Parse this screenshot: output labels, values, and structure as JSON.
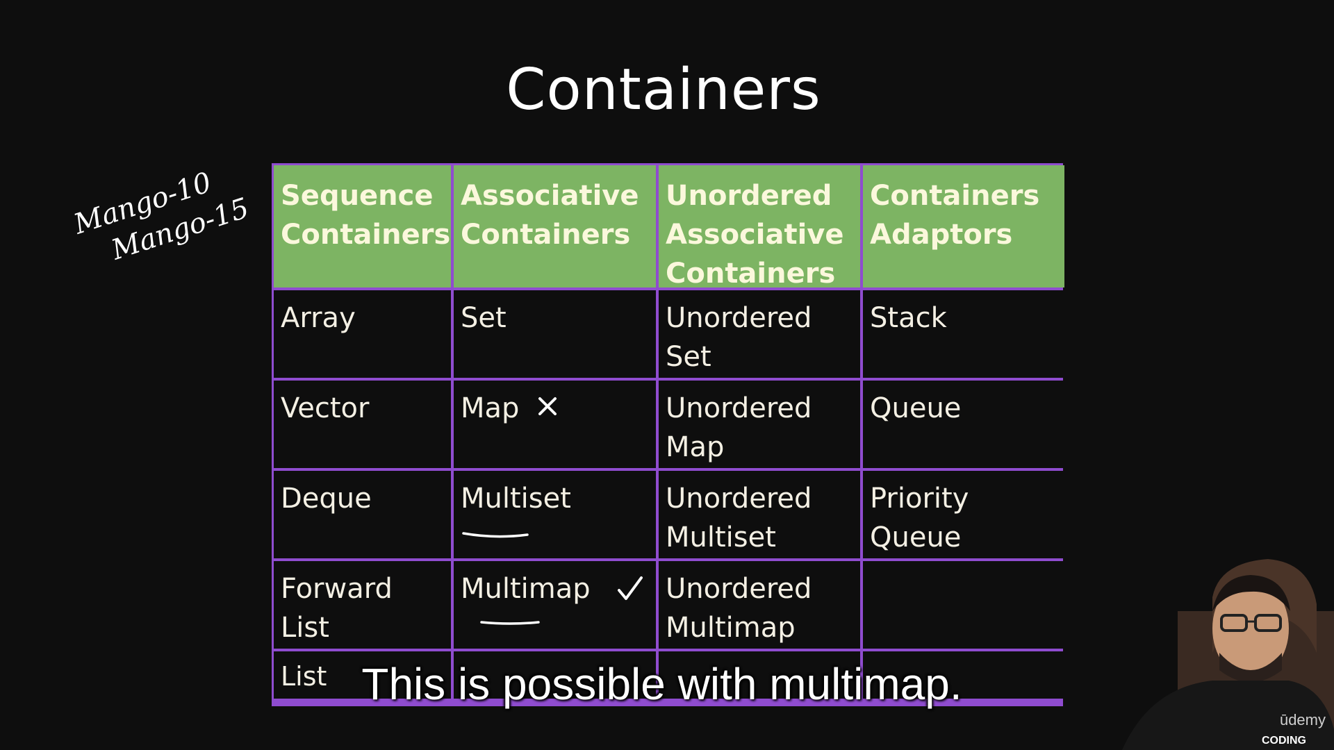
{
  "slide": {
    "title": "Containers"
  },
  "table": {
    "headers": [
      "Sequence\nContainers",
      "Associative\nContainers",
      "Unordered\nAssociative\nContainers",
      "Containers\nAdaptors"
    ],
    "rows": [
      [
        "Array",
        "Set",
        "Unordered\nSet",
        "Stack"
      ],
      [
        "Vector",
        "Map",
        "Unordered\nMap",
        "Queue"
      ],
      [
        "Deque",
        "Multiset",
        "Unordered\nMultiset",
        "Priority\nQueue"
      ],
      [
        "Forward\nList",
        "Multimap",
        "Unordered\nMultimap",
        ""
      ],
      [
        "List",
        "",
        "",
        ""
      ]
    ]
  },
  "annotations": {
    "handwriting": [
      "Mango-10",
      "Mango-15"
    ]
  },
  "caption": "This is possible with multimap.",
  "watermark": {
    "brand": "ūdemy",
    "channel": "CODING"
  },
  "colors": {
    "header_bg": "#7db463",
    "border": "#8f4ccf",
    "background": "#0e0e0e"
  }
}
